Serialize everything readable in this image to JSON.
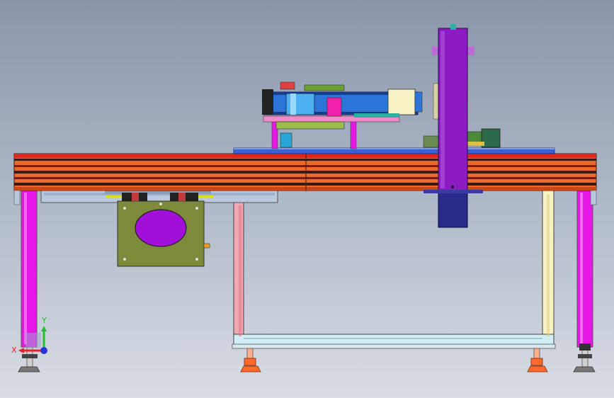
{
  "viewport": {
    "background_top": "#8a95a9",
    "background_bottom": "#d9dde4"
  },
  "triad": {
    "x_label": "X",
    "y_label": "Y",
    "x_color": "#e8202a",
    "y_color": "#23c033",
    "z_color": "#2a35d8"
  },
  "colors": {
    "conveyor_orange": "#ee6a2a",
    "conveyor_red": "#e0281a",
    "conveyor_dark": "#3a1a10",
    "leg_magenta": "#e616e6",
    "column_purple": "#8d1bc4",
    "column_navy": "#2a2a8a",
    "plate_olive": "#7d8a3a",
    "frame_pink": "#f3a7b5",
    "frame_cream": "#f7f2c4",
    "frame_lightblue": "#cfeef6",
    "rail_blue": "#3a5fd8",
    "belt_blue": "#2b74d8",
    "foot_orange": "#ff6a2a"
  }
}
